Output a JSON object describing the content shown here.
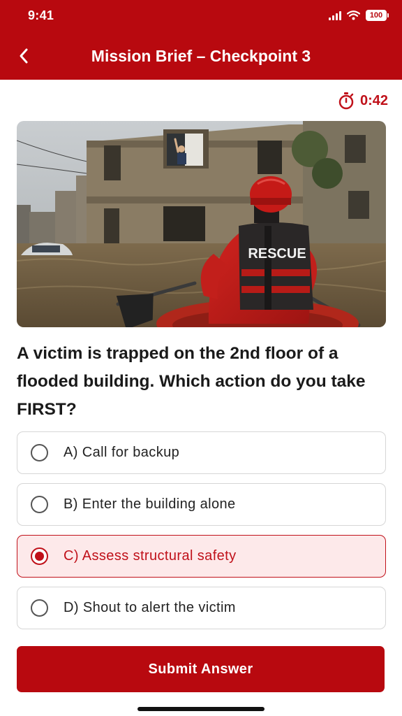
{
  "status_bar": {
    "time": "9:41",
    "battery": "100",
    "icons": [
      "signal-icon",
      "wifi-icon",
      "battery-icon"
    ]
  },
  "header": {
    "title": "Mission Brief – Checkpoint 3",
    "back_icon": "chevron-left-icon"
  },
  "timer": {
    "icon": "stopwatch-icon",
    "value": "0:42"
  },
  "scene": {
    "vest_text": "RESCUE"
  },
  "question": {
    "text": "A victim is trapped on the 2nd floor of a flooded building. Which action do you take FIRST?"
  },
  "options": [
    {
      "label": "A) Call for backup",
      "selected": false
    },
    {
      "label": "B) Enter the building alone",
      "selected": false
    },
    {
      "label": "C) Assess structural safety",
      "selected": true
    },
    {
      "label": "D) Shout to alert the victim",
      "selected": false
    }
  ],
  "submit": {
    "label": "Submit Answer"
  },
  "colors": {
    "brand": "#b8090f",
    "selected_bg": "#fde9ea",
    "accent": "#c0111a"
  }
}
